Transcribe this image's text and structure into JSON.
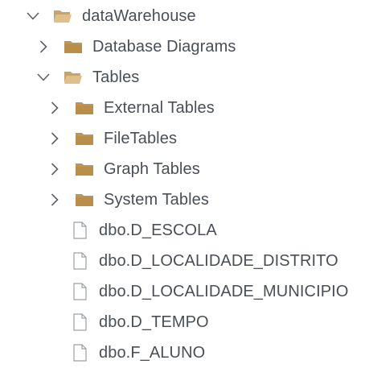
{
  "tree": {
    "root": {
      "label": "dataWarehouse",
      "expanded": true,
      "icon": "folder-open-icon"
    },
    "database_diagrams": {
      "label": "Database Diagrams",
      "expanded": false,
      "icon": "folder-icon"
    },
    "tables": {
      "label": "Tables",
      "expanded": true,
      "icon": "folder-open-icon",
      "folders": [
        {
          "label": "External Tables",
          "icon": "folder-icon"
        },
        {
          "label": "FileTables",
          "icon": "folder-icon"
        },
        {
          "label": "Graph Tables",
          "icon": "folder-icon"
        },
        {
          "label": "System Tables",
          "icon": "folder-icon"
        }
      ],
      "items": [
        {
          "label": "dbo.D_ESCOLA",
          "icon": "file-icon"
        },
        {
          "label": "dbo.D_LOCALIDADE_DISTRITO",
          "icon": "file-icon"
        },
        {
          "label": "dbo.D_LOCALIDADE_MUNICIPIO",
          "icon": "file-icon"
        },
        {
          "label": "dbo.D_TEMPO",
          "icon": "file-icon"
        },
        {
          "label": "dbo.F_ALUNO",
          "icon": "file-icon"
        }
      ]
    }
  },
  "colors": {
    "text": "#4a4f57",
    "folder": "#c09553",
    "folder_open": "#d3b27a",
    "chevron": "#5c6066",
    "file_outline": "#9aa0a6"
  }
}
